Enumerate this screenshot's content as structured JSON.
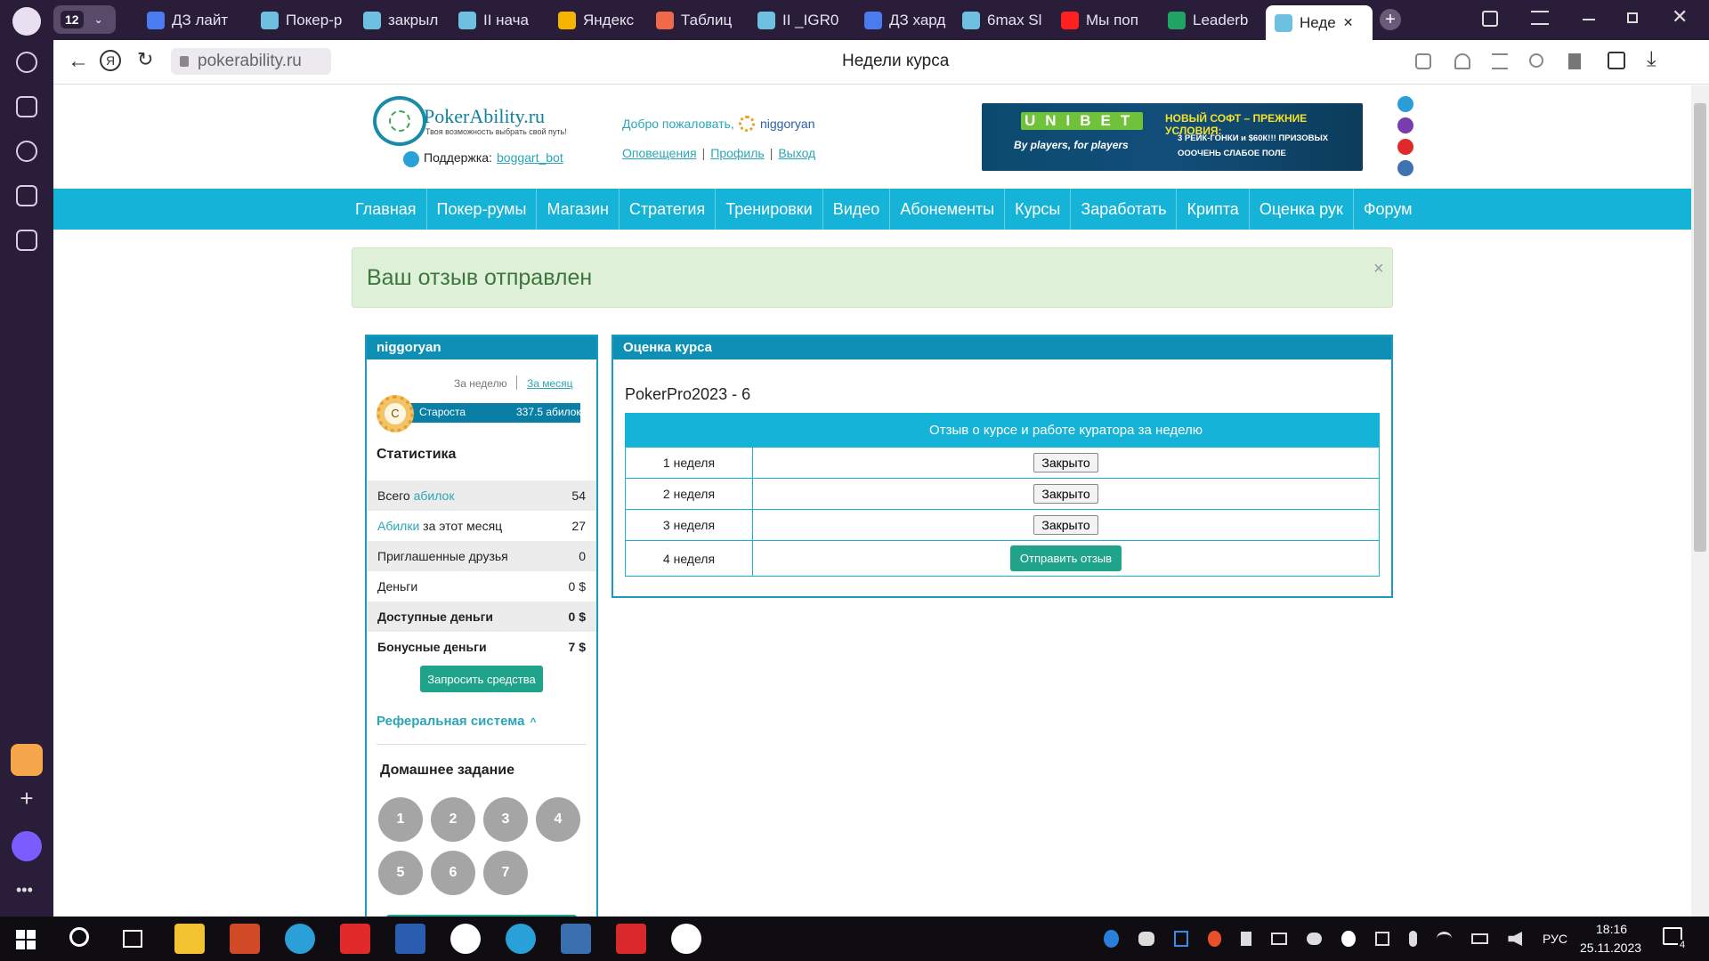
{
  "browser": {
    "tab_count": "12",
    "tabs": [
      {
        "label": "ДЗ лайт",
        "color": "#4a7bf0"
      },
      {
        "label": "Покер-р",
        "color": "#6ec0e0"
      },
      {
        "label": "закрыл",
        "color": "#6ec0e0"
      },
      {
        "label": "II нача",
        "color": "#6ec0e0"
      },
      {
        "label": "Яндекс",
        "color": "#f5b400"
      },
      {
        "label": "Таблиц",
        "color": "#f06a4a"
      },
      {
        "label": "II _IGR0",
        "color": "#6ec0e0"
      },
      {
        "label": "ДЗ хард",
        "color": "#4a7bf0"
      },
      {
        "label": "6max Sl",
        "color": "#6ec0e0"
      },
      {
        "label": "Мы поп",
        "color": "#ff2020"
      },
      {
        "label": "Leaderb",
        "color": "#21a366"
      },
      {
        "label": "Неде",
        "color": "#6ec0e0"
      }
    ],
    "url": "pokerability.ru",
    "page_title": "Недели курса"
  },
  "site": {
    "logo_text": "PokerAbility.ru",
    "logo_tagline": "Твоя возможность выбрать свой путь!",
    "support_label": "Поддержка:",
    "support_link": "boggart_bot",
    "welcome": "Добро пожаловать,",
    "username": "niggoryan",
    "user_links": [
      "Оповещения",
      "Профиль",
      "Выход"
    ],
    "banner": {
      "brand": "UNIBET",
      "slogan": "By players, for players",
      "headline": "НОВЫЙ СОФТ – ПРЕЖНИЕ УСЛОВИЯ:",
      "line1": "3 РЕЙК-ГОНКИ и $60К!!! ПРИЗОВЫХ",
      "line2": "ОООЧЕНЬ СЛАБОЕ ПОЛЕ"
    },
    "nav": [
      "Главная",
      "Покер-румы",
      "Магазин",
      "Стратегия",
      "Тренировки",
      "Видео",
      "Абонементы",
      "Курсы",
      "Заработать",
      "Крипта",
      "Оценка рук",
      "Форум"
    ]
  },
  "alert": {
    "message": "Ваш отзыв отправлен",
    "close": "×"
  },
  "sidebar": {
    "username": "niggoryan",
    "period_week": "За неделю",
    "period_month": "За месяц",
    "rank_badge": "C",
    "rank": "Староста",
    "rank_points": "337.5 абилок",
    "stats_title": "Статистика",
    "stats": [
      {
        "label_prefix": "Всего ",
        "label_link": "абилок",
        "label_suffix": "",
        "value": "54"
      },
      {
        "label_prefix": "",
        "label_link": "Абилки",
        "label_suffix": " за этот месяц",
        "value": "27"
      },
      {
        "label_prefix": "Приглашенные друзья",
        "label_link": "",
        "label_suffix": "",
        "value": "0"
      },
      {
        "label_prefix": "Деньги",
        "label_link": "",
        "label_suffix": "",
        "value": "0 $"
      },
      {
        "label_prefix": "Доступные деньги",
        "label_link": "",
        "label_suffix": "",
        "value": "0 $"
      },
      {
        "label_prefix": "Бонусные деньги",
        "label_link": "",
        "label_suffix": "",
        "value": "7 $"
      }
    ],
    "request_button": "Запросить средства",
    "referral": "Реферальная система",
    "homework_title": "Домашнее задание",
    "homework": [
      "1",
      "2",
      "3",
      "4",
      "5",
      "6",
      "7"
    ]
  },
  "main": {
    "panel_title": "Оценка курса",
    "course": "PokerPro2023 - 6",
    "table_header": "Отзыв о курсе и работе куратора за неделю",
    "rows": [
      {
        "week": "1 неделя",
        "action": "Закрыто"
      },
      {
        "week": "2 неделя",
        "action": "Закрыто"
      },
      {
        "week": "3 неделя",
        "action": "Закрыто"
      },
      {
        "week": "4 неделя",
        "action": "Отправить отзыв"
      }
    ]
  },
  "taskbar": {
    "lang": "РУС",
    "time": "18:16",
    "date": "25.11.2023",
    "notifications": "4"
  }
}
